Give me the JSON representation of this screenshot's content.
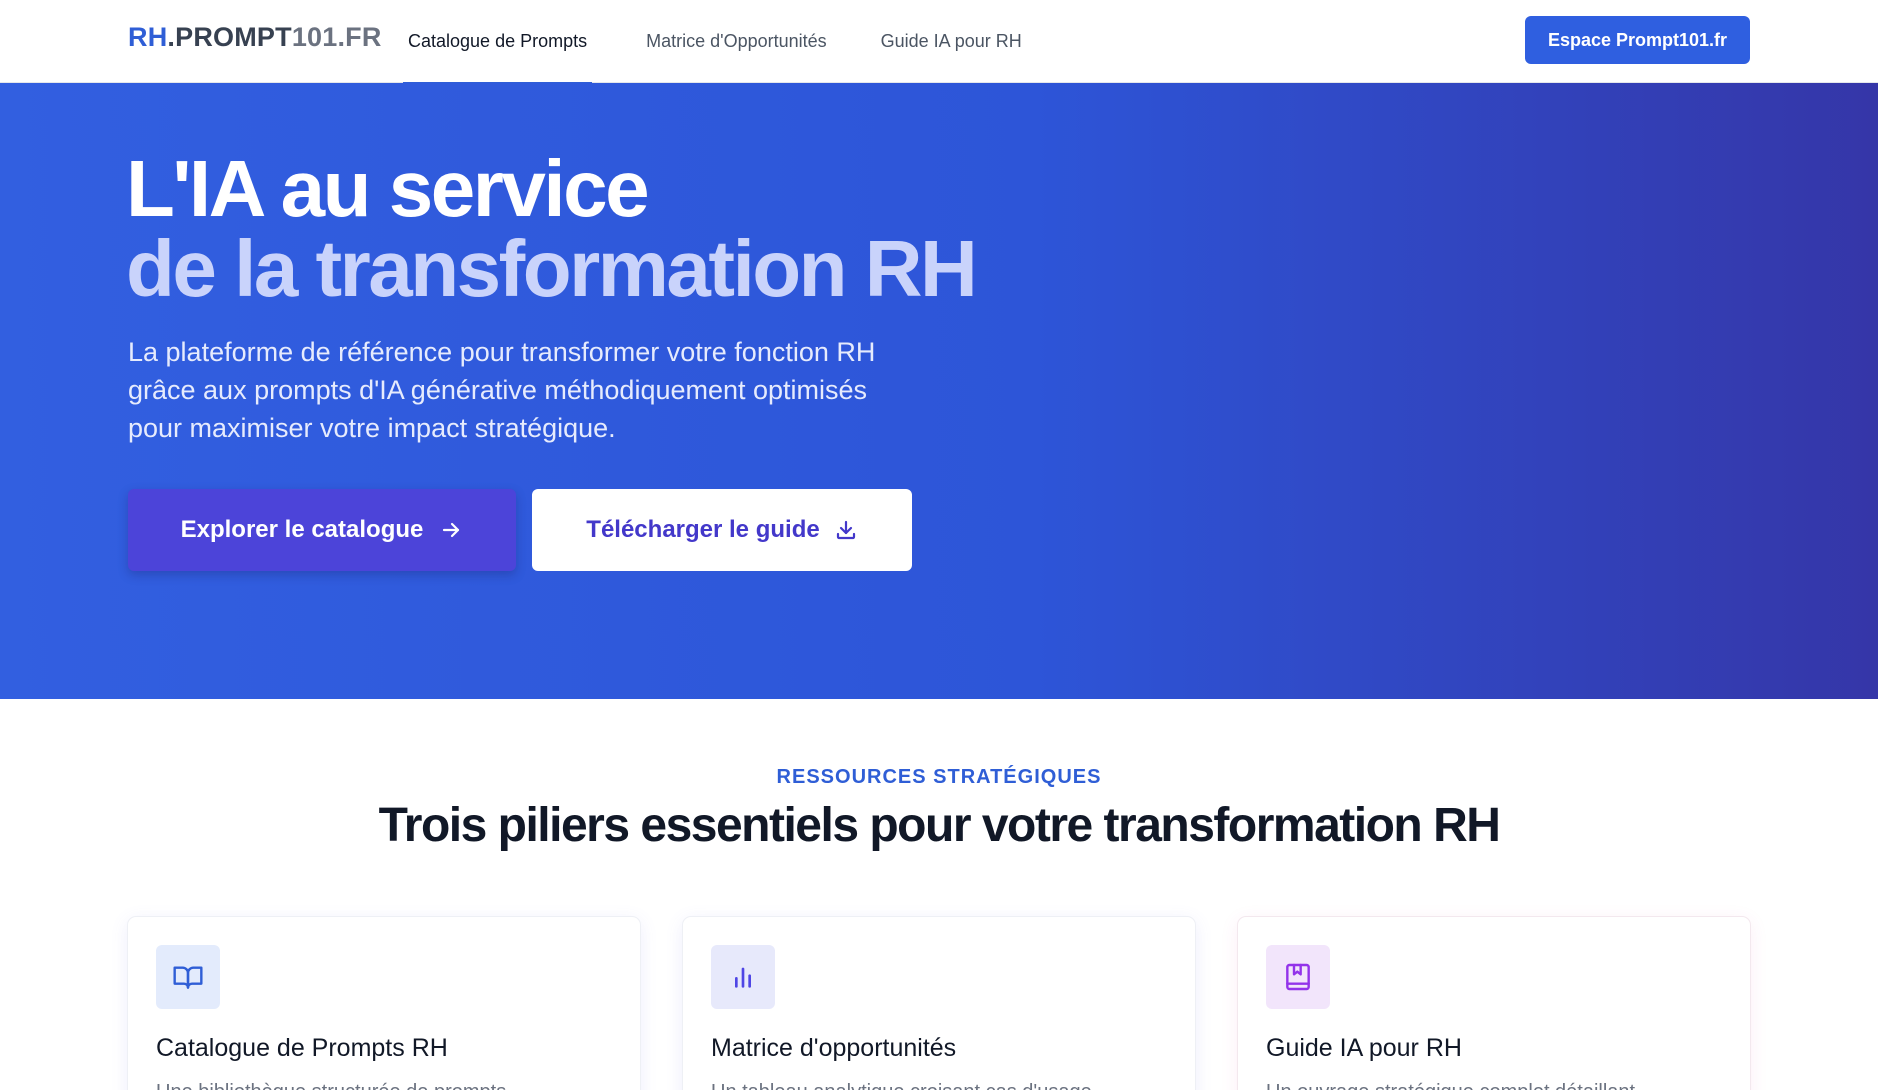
{
  "header": {
    "logo": {
      "rh": "RH",
      "mid": ".PROMPT",
      "tail": "101.FR"
    },
    "nav": [
      {
        "label": "Catalogue de Prompts",
        "active": true
      },
      {
        "label": "Matrice d'Opportunités",
        "active": false
      },
      {
        "label": "Guide IA pour RH",
        "active": false
      }
    ],
    "cta_label": "Espace Prompt101.fr"
  },
  "hero": {
    "title_line1": "L'IA au service",
    "title_line2": "de la transformation RH",
    "subtitle": "La plateforme de référence pour transformer votre fonction RH grâce aux prompts d'IA générative méthodiquement optimisés pour maximiser votre impact stratégique.",
    "primary_button": "Explorer le catalogue",
    "secondary_button": "Télécharger le guide"
  },
  "section": {
    "eyebrow": "RESSOURCES STRATÉGIQUES",
    "title": "Trois piliers essentiels pour votre transformation RH"
  },
  "cards": [
    {
      "icon": "open-book-icon",
      "title": "Catalogue de Prompts RH",
      "desc": "Une bibliothèque structurée de prompts"
    },
    {
      "icon": "bar-chart-icon",
      "title": "Matrice d'opportunités",
      "desc": "Un tableau analytique croisant cas d'usage"
    },
    {
      "icon": "bookmark-book-icon",
      "title": "Guide IA pour RH",
      "desc": "Un ouvrage stratégique complet détaillant"
    }
  ],
  "colors": {
    "brand": "#2f5ed6",
    "hero_start": "#325fe0",
    "hero_end": "#3536a8",
    "explore_button": "#4c44d9"
  }
}
